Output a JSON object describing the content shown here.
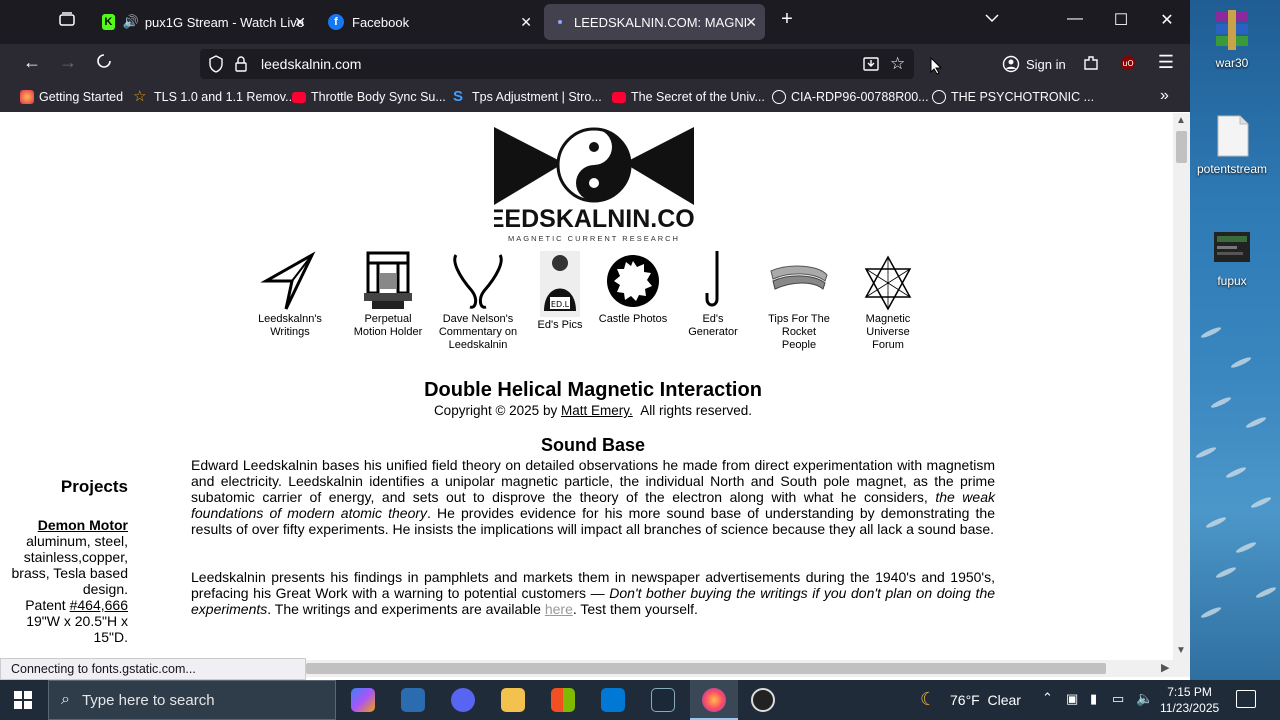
{
  "tabs": [
    {
      "label": "pux1G Stream - Watch Live"
    },
    {
      "label": "Facebook"
    },
    {
      "label": "LEEDSKALNIN.COM: MAGNETIC"
    }
  ],
  "url": "leedskalnin.com",
  "signin": "Sign in",
  "bookmarks": [
    "Getting Started",
    "TLS 1.0 and 1.1 Remov...",
    "Throttle Body Sync Su...",
    "Tps Adjustment | Stro...",
    "The Secret of the Univ...",
    "CIA-RDP96-00788R00...",
    "THE PSYCHOTRONIC ..."
  ],
  "logo": {
    "name": "LEEDSKALNIN.COM",
    "tagline": "MAGNETIC CURRENT RESEARCH"
  },
  "nav_items": [
    {
      "label": "Leedskalnn's Writings"
    },
    {
      "label": "Perpetual Motion Holder"
    },
    {
      "label": "Dave Nelson's Commentary on Leedskalnin"
    },
    {
      "label": "Ed's Pics"
    },
    {
      "label": "Castle Photos"
    },
    {
      "label": "Ed's Generator"
    },
    {
      "label": "Tips For The Rocket People"
    },
    {
      "label": "Magnetic Universe Forum"
    }
  ],
  "ed_badge": "ED.L",
  "article": {
    "title": "Double Helical Magnetic Interaction",
    "copyright_prefix": "Copyright © 2025 by",
    "author": "Matt Emery.",
    "rights": "All rights reserved.",
    "section_title": "Sound Base",
    "p1_a": "Edward Leedskalnin bases his unified field theory on detailed observations he made from direct experimentation with magnetism and electricity.   Leedskalnin identifies a unipolar magnetic particle, the individual North and South pole magnet, as the prime subatomic carrier of energy, and sets out to disprove the theory of the electron along with what he considers,",
    "p1_em": "the weak foundations of modern atomic theory",
    "p1_b": ".  He provides evidence for his more sound base of understanding by demonstrating the results of over fifty experiments.  He insists the implications will impact all branches of science because they  all lack a sound base.",
    "p2_a": "Leedskalnin presents his findings in pamphlets and markets them in newspaper advertisements during the 1940's and 1950's, prefacing his Great Work with a warning to potential customers —",
    "p2_em": "Don't bother buying the writings if you don't plan on doing the experiments",
    "p2_b": ".  The writings and experiments are available",
    "p2_link": "here",
    "p2_c": ".  Test them yourself."
  },
  "sidebar": {
    "heading": "Projects",
    "project_link": "Demon Motor",
    "project_desc": "aluminum, steel, stainless,copper, brass, Tesla based design.",
    "patent_prefix": "Patent",
    "patent_link": "#464,666",
    "dims": "19\"W x 20.5\"H x 15\"D."
  },
  "status": "Connecting to fonts.gstatic.com...",
  "desktop_icons": [
    "war30",
    "potentstream",
    "fupux"
  ],
  "taskbar": {
    "search_placeholder": "Type here to search",
    "weather": "76°F  Clear",
    "time": "7:15 PM",
    "date": "11/23/2025"
  }
}
